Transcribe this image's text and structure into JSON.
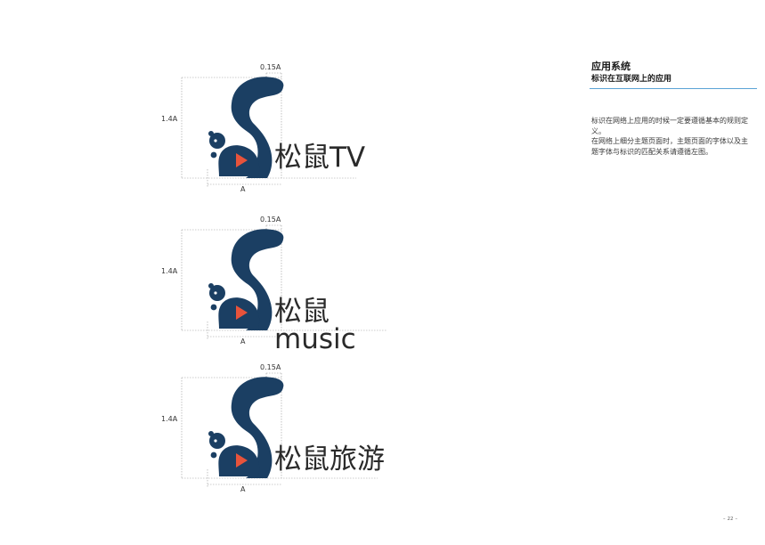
{
  "header": {
    "title": "应用系统",
    "subtitle": "标识在互联网上的应用"
  },
  "body": {
    "paragraph1": "标识在网络上应用的时候一定要遵循基本的规则定义。",
    "paragraph2": "在网络上细分主题页面时，主题页面的字体以及主题字体与标识的匹配关系请遵循左图。"
  },
  "colors": {
    "brand_navy": "#1b3f63",
    "play_red": "#e8533b",
    "accent_rule": "#5aa3d6"
  },
  "specimens": [
    {
      "wordmark": "松鼠TV",
      "dim_top": "0.15A",
      "dim_left": "1.4A",
      "dim_bottom": "A"
    },
    {
      "wordmark": "松鼠music",
      "dim_top": "0.15A",
      "dim_left": "1.4A",
      "dim_bottom": "A"
    },
    {
      "wordmark": "松鼠旅游",
      "dim_top": "0.15A",
      "dim_left": "1.4A",
      "dim_bottom": "A"
    }
  ],
  "footer": {
    "page_number": "– 22 –"
  }
}
